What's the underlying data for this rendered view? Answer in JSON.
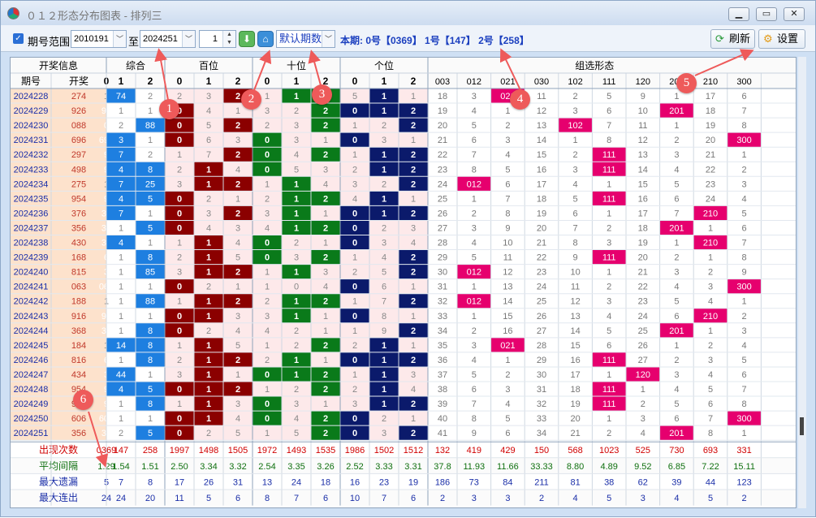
{
  "window": {
    "title": "０１２形态分布图表 - 排列三"
  },
  "toolbar": {
    "range_label": "期号范围",
    "start_issue": "2010191",
    "to_label": "至",
    "end_issue": "2024251",
    "count": "1",
    "default_issue_label": "默认期数",
    "current_period": "本期: 0号【0369】 1号【147】 2号【258】",
    "refresh_label": "刷新",
    "settings_label": "设置"
  },
  "annotations": [
    "1",
    "2",
    "3",
    "4",
    "5",
    "6"
  ],
  "table": {
    "groups": [
      "开奖信息",
      "综合",
      "百位",
      "十位",
      "个位",
      "组选形态"
    ],
    "header_info": [
      "期号",
      "开奖"
    ],
    "header_digits": [
      "0",
      "1",
      "2"
    ],
    "shapes": [
      "003",
      "012",
      "021",
      "030",
      "102",
      "111",
      "120",
      "201",
      "210",
      "300"
    ],
    "rows": [
      {
        "issue": "2024228",
        "draw": "274",
        "zh": [
          "1",
          "74",
          "2"
        ],
        "p": [
          "2",
          "3",
          "2"
        ],
        "shi": [
          "1",
          "1",
          "2"
        ],
        "ge": [
          "5",
          "1",
          "1"
        ],
        "shape": [
          "18",
          "3",
          "021",
          "11",
          "2",
          "5",
          "9",
          "1",
          "17",
          "6"
        ]
      },
      {
        "issue": "2024229",
        "draw": "926",
        "zh": [
          "96",
          "1",
          "1"
        ],
        "p": [
          "0",
          "4",
          "1"
        ],
        "shi": [
          "3",
          "2",
          "2"
        ],
        "ge": [
          "0",
          "1",
          "2"
        ],
        "shape": [
          "19",
          "4",
          "1",
          "12",
          "3",
          "6",
          "10",
          "201",
          "18",
          "7"
        ]
      },
      {
        "issue": "2024230",
        "draw": "088",
        "zh": [
          "0",
          "2",
          "88"
        ],
        "p": [
          "0",
          "5",
          "2"
        ],
        "shi": [
          "2",
          "3",
          "2"
        ],
        "ge": [
          "1",
          "2",
          "2"
        ],
        "shape": [
          "20",
          "5",
          "2",
          "13",
          "102",
          "7",
          "11",
          "1",
          "19",
          "8"
        ]
      },
      {
        "issue": "2024231",
        "draw": "696",
        "zh": [
          "696",
          "3",
          "1"
        ],
        "p": [
          "0",
          "6",
          "3"
        ],
        "shi": [
          "0",
          "3",
          "1"
        ],
        "ge": [
          "0",
          "3",
          "1"
        ],
        "shape": [
          "21",
          "6",
          "3",
          "14",
          "1",
          "8",
          "12",
          "2",
          "20",
          "300"
        ]
      },
      {
        "issue": "2024232",
        "draw": "297",
        "zh": [
          "9",
          "7",
          "2"
        ],
        "p": [
          "1",
          "7",
          "2"
        ],
        "shi": [
          "0",
          "4",
          "2"
        ],
        "ge": [
          "1",
          "1",
          "2"
        ],
        "shape": [
          "22",
          "7",
          "4",
          "15",
          "2",
          "111",
          "13",
          "3",
          "21",
          "1"
        ]
      },
      {
        "issue": "2024233",
        "draw": "498",
        "zh": [
          "9",
          "4",
          "8"
        ],
        "p": [
          "2",
          "1",
          "4"
        ],
        "shi": [
          "0",
          "5",
          "3"
        ],
        "ge": [
          "2",
          "1",
          "2"
        ],
        "shape": [
          "23",
          "8",
          "5",
          "16",
          "3",
          "111",
          "14",
          "4",
          "22",
          "2"
        ]
      },
      {
        "issue": "2024234",
        "draw": "275",
        "zh": [
          "1",
          "7",
          "25"
        ],
        "p": [
          "3",
          "1",
          "2"
        ],
        "shi": [
          "1",
          "1",
          "4"
        ],
        "ge": [
          "3",
          "2",
          "2"
        ],
        "shape": [
          "24",
          "012",
          "6",
          "17",
          "4",
          "1",
          "15",
          "5",
          "23",
          "3"
        ]
      },
      {
        "issue": "2024235",
        "draw": "954",
        "zh": [
          "9",
          "4",
          "5"
        ],
        "p": [
          "0",
          "2",
          "1"
        ],
        "shi": [
          "2",
          "1",
          "2"
        ],
        "ge": [
          "4",
          "1",
          "1"
        ],
        "shape": [
          "25",
          "1",
          "7",
          "18",
          "5",
          "111",
          "16",
          "6",
          "24",
          "4"
        ]
      },
      {
        "issue": "2024236",
        "draw": "376",
        "zh": [
          "36",
          "7",
          "1"
        ],
        "p": [
          "0",
          "3",
          "2"
        ],
        "shi": [
          "3",
          "1",
          "1"
        ],
        "ge": [
          "0",
          "1",
          "2"
        ],
        "shape": [
          "26",
          "2",
          "8",
          "19",
          "6",
          "1",
          "17",
          "7",
          "210",
          "5"
        ]
      },
      {
        "issue": "2024237",
        "draw": "356",
        "zh": [
          "36",
          "1",
          "5"
        ],
        "p": [
          "0",
          "4",
          "3"
        ],
        "shi": [
          "4",
          "1",
          "2"
        ],
        "ge": [
          "0",
          "2",
          "3"
        ],
        "shape": [
          "27",
          "3",
          "9",
          "20",
          "7",
          "2",
          "18",
          "201",
          "1",
          "6"
        ]
      },
      {
        "issue": "2024238",
        "draw": "430",
        "zh": [
          "30",
          "4",
          "1"
        ],
        "p": [
          "1",
          "1",
          "4"
        ],
        "shi": [
          "0",
          "2",
          "1"
        ],
        "ge": [
          "0",
          "3",
          "4"
        ],
        "shape": [
          "28",
          "4",
          "10",
          "21",
          "8",
          "3",
          "19",
          "1",
          "210",
          "7"
        ]
      },
      {
        "issue": "2024239",
        "draw": "168",
        "zh": [
          "6",
          "1",
          "8"
        ],
        "p": [
          "2",
          "1",
          "5"
        ],
        "shi": [
          "0",
          "3",
          "2"
        ],
        "ge": [
          "1",
          "4",
          "2"
        ],
        "shape": [
          "29",
          "5",
          "11",
          "22",
          "9",
          "111",
          "20",
          "2",
          "1",
          "8"
        ]
      },
      {
        "issue": "2024240",
        "draw": "815",
        "zh": [
          "3",
          "1",
          "85"
        ],
        "p": [
          "3",
          "1",
          "2"
        ],
        "shi": [
          "1",
          "1",
          "3"
        ],
        "ge": [
          "2",
          "5",
          "2"
        ],
        "shape": [
          "30",
          "012",
          "12",
          "23",
          "10",
          "1",
          "21",
          "3",
          "2",
          "9"
        ]
      },
      {
        "issue": "2024241",
        "draw": "063",
        "zh": [
          "063",
          "1",
          "1"
        ],
        "p": [
          "0",
          "2",
          "1"
        ],
        "shi": [
          "1",
          "0",
          "4"
        ],
        "ge": [
          "0",
          "6",
          "1"
        ],
        "shape": [
          "31",
          "1",
          "13",
          "24",
          "11",
          "2",
          "22",
          "4",
          "3",
          "300"
        ]
      },
      {
        "issue": "2024242",
        "draw": "188",
        "zh": [
          "1",
          "1",
          "88"
        ],
        "p": [
          "1",
          "1",
          "2"
        ],
        "shi": [
          "2",
          "1",
          "2"
        ],
        "ge": [
          "1",
          "7",
          "2"
        ],
        "shape": [
          "32",
          "012",
          "14",
          "25",
          "12",
          "3",
          "23",
          "5",
          "4",
          "1"
        ]
      },
      {
        "issue": "2024243",
        "draw": "916",
        "zh": [
          "96",
          "1",
          "1"
        ],
        "p": [
          "0",
          "1",
          "3"
        ],
        "shi": [
          "3",
          "1",
          "1"
        ],
        "ge": [
          "0",
          "8",
          "1"
        ],
        "shape": [
          "33",
          "1",
          "15",
          "26",
          "13",
          "4",
          "24",
          "6",
          "210",
          "2"
        ]
      },
      {
        "issue": "2024244",
        "draw": "368",
        "zh": [
          "36",
          "1",
          "8"
        ],
        "p": [
          "0",
          "2",
          "4"
        ],
        "shi": [
          "4",
          "2",
          "1"
        ],
        "ge": [
          "1",
          "9",
          "2"
        ],
        "shape": [
          "34",
          "2",
          "16",
          "27",
          "14",
          "5",
          "25",
          "201",
          "1",
          "3"
        ]
      },
      {
        "issue": "2024245",
        "draw": "184",
        "zh": [
          "1",
          "14",
          "8"
        ],
        "p": [
          "1",
          "1",
          "5"
        ],
        "shi": [
          "1",
          "2",
          "2"
        ],
        "ge": [
          "2",
          "1",
          "1"
        ],
        "shape": [
          "35",
          "3",
          "021",
          "28",
          "15",
          "6",
          "26",
          "1",
          "2",
          "4"
        ]
      },
      {
        "issue": "2024246",
        "draw": "816",
        "zh": [
          "6",
          "1",
          "8"
        ],
        "p": [
          "2",
          "1",
          "2"
        ],
        "shi": [
          "2",
          "1",
          "1"
        ],
        "ge": [
          "0",
          "1",
          "2"
        ],
        "shape": [
          "36",
          "4",
          "1",
          "29",
          "16",
          "111",
          "27",
          "2",
          "3",
          "5"
        ]
      },
      {
        "issue": "2024247",
        "draw": "434",
        "zh": [
          "3",
          "44",
          "1"
        ],
        "p": [
          "3",
          "1",
          "1"
        ],
        "shi": [
          "0",
          "1",
          "2"
        ],
        "ge": [
          "1",
          "1",
          "3"
        ],
        "shape": [
          "37",
          "5",
          "2",
          "30",
          "17",
          "1",
          "120",
          "3",
          "4",
          "6"
        ]
      },
      {
        "issue": "2024248",
        "draw": "954",
        "zh": [
          "9",
          "4",
          "5"
        ],
        "p": [
          "0",
          "1",
          "2"
        ],
        "shi": [
          "1",
          "2",
          "2"
        ],
        "ge": [
          "2",
          "1",
          "4"
        ],
        "shape": [
          "38",
          "6",
          "3",
          "31",
          "18",
          "111",
          "1",
          "4",
          "5",
          "7"
        ]
      },
      {
        "issue": "2024249",
        "draw": "918",
        "zh": [
          "9",
          "1",
          "8"
        ],
        "p": [
          "1",
          "1",
          "3"
        ],
        "shi": [
          "0",
          "3",
          "1"
        ],
        "ge": [
          "3",
          "1",
          "2"
        ],
        "shape": [
          "39",
          "7",
          "4",
          "32",
          "19",
          "111",
          "2",
          "5",
          "6",
          "8"
        ]
      },
      {
        "issue": "2024250",
        "draw": "606",
        "zh": [
          "606",
          "1",
          "1"
        ],
        "p": [
          "0",
          "1",
          "4"
        ],
        "shi": [
          "0",
          "4",
          "2"
        ],
        "ge": [
          "0",
          "2",
          "1"
        ],
        "shape": [
          "40",
          "8",
          "5",
          "33",
          "20",
          "1",
          "3",
          "6",
          "7",
          "300"
        ]
      },
      {
        "issue": "2024251",
        "draw": "356",
        "zh": [
          "36",
          "2",
          "5"
        ],
        "p": [
          "0",
          "2",
          "5"
        ],
        "shi": [
          "1",
          "5",
          "2"
        ],
        "ge": [
          "0",
          "3",
          "2"
        ],
        "shape": [
          "41",
          "9",
          "6",
          "34",
          "21",
          "2",
          "4",
          "201",
          "8",
          "1"
        ]
      }
    ],
    "stats": [
      {
        "label": "出现次数",
        "values": [
          "0369",
          "147",
          "258",
          "1997",
          "1498",
          "1505",
          "1972",
          "1493",
          "1535",
          "1986",
          "1502",
          "1512",
          "132",
          "419",
          "429",
          "150",
          "568",
          "1023",
          "525",
          "730",
          "693",
          "331"
        ]
      },
      {
        "label": "平均间隔",
        "values": [
          "1.29",
          "1.54",
          "1.51",
          "2.50",
          "3.34",
          "3.32",
          "2.54",
          "3.35",
          "3.26",
          "2.52",
          "3.33",
          "3.31",
          "37.8",
          "11.93",
          "11.66",
          "33.33",
          "8.80",
          "4.89",
          "9.52",
          "6.85",
          "7.22",
          "15.11"
        ]
      },
      {
        "label": "最大遗漏",
        "values": [
          "5",
          "7",
          "8",
          "17",
          "26",
          "31",
          "13",
          "24",
          "18",
          "16",
          "23",
          "19",
          "186",
          "73",
          "84",
          "211",
          "81",
          "38",
          "62",
          "39",
          "44",
          "123"
        ]
      },
      {
        "label": "最大连出",
        "values": [
          "24",
          "24",
          "20",
          "11",
          "5",
          "6",
          "8",
          "7",
          "6",
          "10",
          "7",
          "6",
          "2",
          "3",
          "3",
          "2",
          "4",
          "5",
          "3",
          "4",
          "5",
          "2"
        ]
      }
    ]
  },
  "colors": {
    "zh_hit": "#1e7fe0",
    "pos_hit": "#8b0000",
    "shi_hit": "#0a7a1a",
    "ge_hit": "#0b1a6b",
    "shape_hit": "#e6006e",
    "pos_bg": "#fde9ea",
    "info_bg": "#fde2cc",
    "stat_red": "#d00000",
    "stat_green": "#107010",
    "stat_blue": "#1b2fa8"
  }
}
